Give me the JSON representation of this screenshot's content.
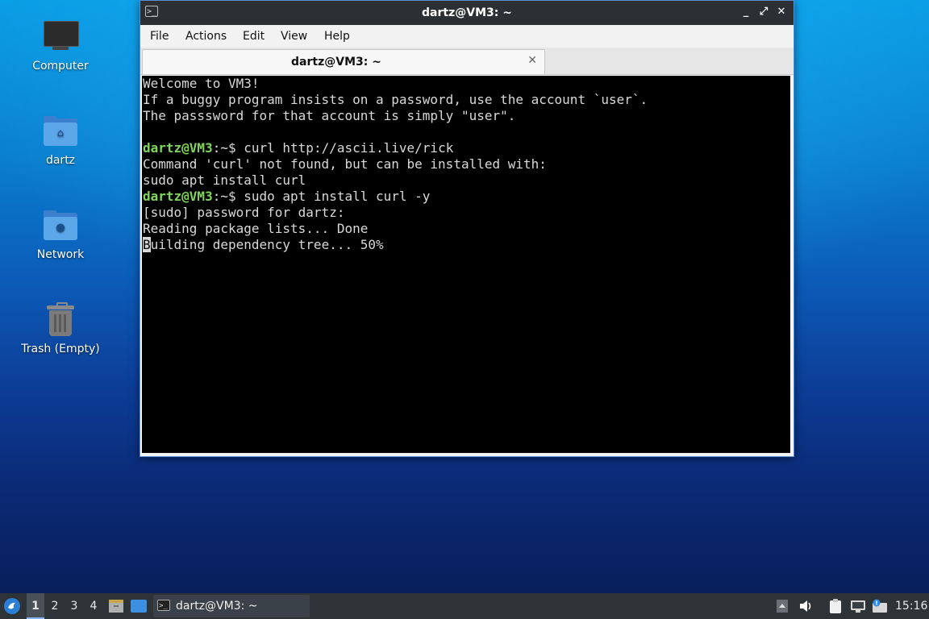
{
  "desktop": {
    "icons": [
      {
        "label": "Computer"
      },
      {
        "label": "dartz"
      },
      {
        "label": "Network"
      },
      {
        "label": "Trash (Empty)"
      }
    ]
  },
  "window": {
    "title": "dartz@VM3: ~",
    "menu": [
      "File",
      "Actions",
      "Edit",
      "View",
      "Help"
    ],
    "tab": {
      "label": "dartz@VM3: ~"
    }
  },
  "terminal": {
    "lines": [
      "Welcome to VM3!",
      "If a buggy program insists on a password, use the account `user`.",
      "The passsword for that account is simply \"user\".",
      "",
      "Command 'curl' not found, but can be installed with:",
      "sudo apt install curl",
      "[sudo] password for dartz:",
      "Reading package lists... Done",
      "Building dependency tree... 50%"
    ],
    "prompts": [
      {
        "user": "dartz@VM3",
        "path": ":~",
        "symbol": "$",
        "command": " curl http://ascii.live/rick"
      },
      {
        "user": "dartz@VM3",
        "path": ":~",
        "symbol": "$",
        "command": " sudo apt install curl -y"
      }
    ],
    "cursor_char": "B",
    "cursor_rest": "uilding dependency tree... 50%"
  },
  "taskbar": {
    "workspaces": [
      "1",
      "2",
      "3",
      "4"
    ],
    "active_workspace": "1",
    "task_label": "dartz@VM3: ~",
    "clock": "15:16"
  },
  "colors": {
    "prompt_user": "#7fd65a",
    "terminal_bg": "#000000",
    "titlebar_bg": "#2c2f33",
    "taskbar_bg": "#2e3338"
  }
}
